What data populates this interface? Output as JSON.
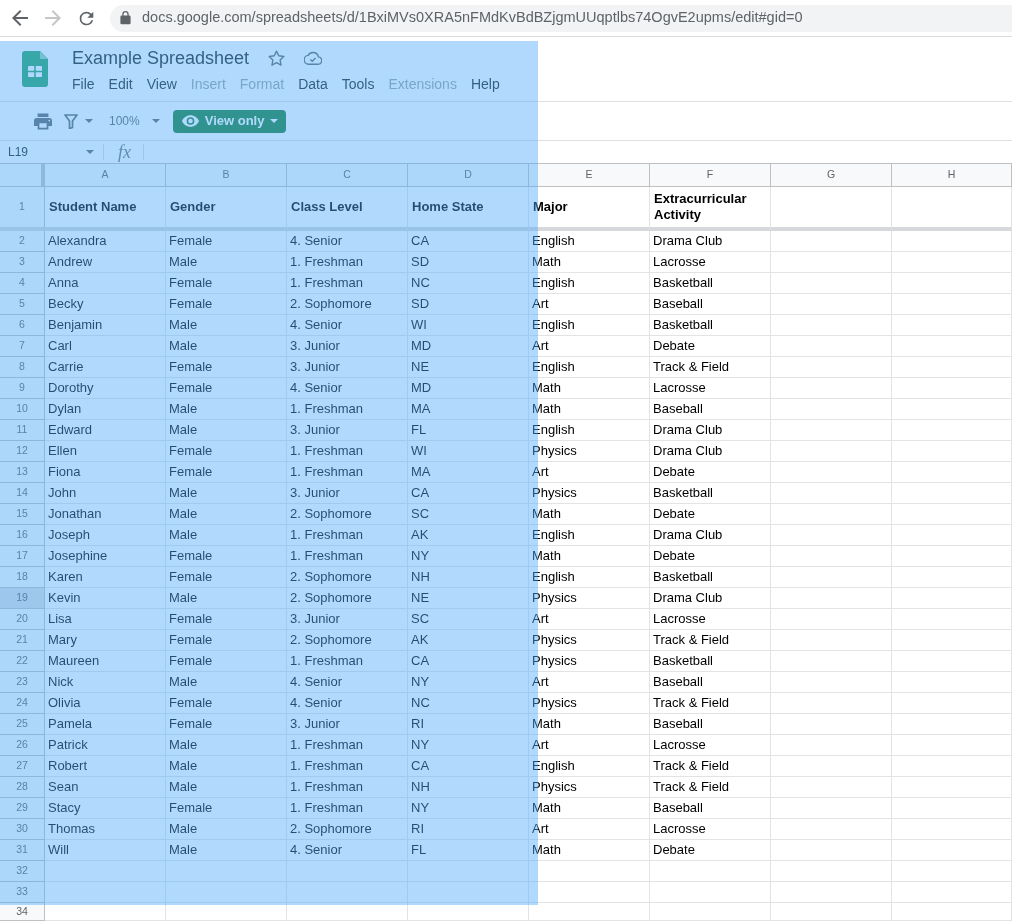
{
  "browser": {
    "back_disabled": false,
    "forward_disabled": true,
    "url": "docs.google.com/spreadsheets/d/1BxiMVs0XRA5nFMdKvBdBZjgmUUqptlbs74OgvE2upms/edit#gid=0"
  },
  "document": {
    "title": "Example Spreadsheet",
    "starred": false
  },
  "menu": [
    {
      "label": "File",
      "disabled": false
    },
    {
      "label": "Edit",
      "disabled": false
    },
    {
      "label": "View",
      "disabled": false
    },
    {
      "label": "Insert",
      "disabled": true
    },
    {
      "label": "Format",
      "disabled": true
    },
    {
      "label": "Data",
      "disabled": false
    },
    {
      "label": "Tools",
      "disabled": false
    },
    {
      "label": "Extensions",
      "disabled": true
    },
    {
      "label": "Help",
      "disabled": false
    }
  ],
  "toolbar": {
    "zoom": "100%",
    "mode_button": "View only"
  },
  "formula_bar": {
    "cell_reference": "L19",
    "function_label": "fx"
  },
  "sheet": {
    "columns": [
      "A",
      "B",
      "C",
      "D",
      "E",
      "F",
      "G",
      "H"
    ],
    "rows": [
      {
        "number": "1",
        "kind": "header",
        "selected": false,
        "cells": [
          "Student Name",
          "Gender",
          "Class Level",
          "Home State",
          "Major",
          "Extracurricular Activity"
        ]
      },
      {
        "number": "2",
        "kind": "data",
        "selected": false,
        "cells": [
          "Alexandra",
          "Female",
          "4. Senior",
          "CA",
          "English",
          "Drama Club"
        ]
      },
      {
        "number": "3",
        "kind": "data",
        "selected": false,
        "cells": [
          "Andrew",
          "Male",
          "1. Freshman",
          "SD",
          "Math",
          "Lacrosse"
        ]
      },
      {
        "number": "4",
        "kind": "data",
        "selected": false,
        "cells": [
          "Anna",
          "Female",
          "1. Freshman",
          "NC",
          "English",
          "Basketball"
        ]
      },
      {
        "number": "5",
        "kind": "data",
        "selected": false,
        "cells": [
          "Becky",
          "Female",
          "2. Sophomore",
          "SD",
          "Art",
          "Baseball"
        ]
      },
      {
        "number": "6",
        "kind": "data",
        "selected": false,
        "cells": [
          "Benjamin",
          "Male",
          "4. Senior",
          "WI",
          "English",
          "Basketball"
        ]
      },
      {
        "number": "7",
        "kind": "data",
        "selected": false,
        "cells": [
          "Carl",
          "Male",
          "3. Junior",
          "MD",
          "Art",
          "Debate"
        ]
      },
      {
        "number": "8",
        "kind": "data",
        "selected": false,
        "cells": [
          "Carrie",
          "Female",
          "3. Junior",
          "NE",
          "English",
          "Track & Field"
        ]
      },
      {
        "number": "9",
        "kind": "data",
        "selected": false,
        "cells": [
          "Dorothy",
          "Female",
          "4. Senior",
          "MD",
          "Math",
          "Lacrosse"
        ]
      },
      {
        "number": "10",
        "kind": "data",
        "selected": false,
        "cells": [
          "Dylan",
          "Male",
          "1. Freshman",
          "MA",
          "Math",
          "Baseball"
        ]
      },
      {
        "number": "11",
        "kind": "data",
        "selected": false,
        "cells": [
          "Edward",
          "Male",
          "3. Junior",
          "FL",
          "English",
          "Drama Club"
        ]
      },
      {
        "number": "12",
        "kind": "data",
        "selected": false,
        "cells": [
          "Ellen",
          "Female",
          "1. Freshman",
          "WI",
          "Physics",
          "Drama Club"
        ]
      },
      {
        "number": "13",
        "kind": "data",
        "selected": false,
        "cells": [
          "Fiona",
          "Female",
          "1. Freshman",
          "MA",
          "Art",
          "Debate"
        ]
      },
      {
        "number": "14",
        "kind": "data",
        "selected": false,
        "cells": [
          "John",
          "Male",
          "3. Junior",
          "CA",
          "Physics",
          "Basketball"
        ]
      },
      {
        "number": "15",
        "kind": "data",
        "selected": false,
        "cells": [
          "Jonathan",
          "Male",
          "2. Sophomore",
          "SC",
          "Math",
          "Debate"
        ]
      },
      {
        "number": "16",
        "kind": "data",
        "selected": false,
        "cells": [
          "Joseph",
          "Male",
          "1. Freshman",
          "AK",
          "English",
          "Drama Club"
        ]
      },
      {
        "number": "17",
        "kind": "data",
        "selected": false,
        "cells": [
          "Josephine",
          "Female",
          "1. Freshman",
          "NY",
          "Math",
          "Debate"
        ]
      },
      {
        "number": "18",
        "kind": "data",
        "selected": false,
        "cells": [
          "Karen",
          "Female",
          "2. Sophomore",
          "NH",
          "English",
          "Basketball"
        ]
      },
      {
        "number": "19",
        "kind": "data",
        "selected": true,
        "cells": [
          "Kevin",
          "Male",
          "2. Sophomore",
          "NE",
          "Physics",
          "Drama Club"
        ]
      },
      {
        "number": "20",
        "kind": "data",
        "selected": false,
        "cells": [
          "Lisa",
          "Female",
          "3. Junior",
          "SC",
          "Art",
          "Lacrosse"
        ]
      },
      {
        "number": "21",
        "kind": "data",
        "selected": false,
        "cells": [
          "Mary",
          "Female",
          "2. Sophomore",
          "AK",
          "Physics",
          "Track & Field"
        ]
      },
      {
        "number": "22",
        "kind": "data",
        "selected": false,
        "cells": [
          "Maureen",
          "Female",
          "1. Freshman",
          "CA",
          "Physics",
          "Basketball"
        ]
      },
      {
        "number": "23",
        "kind": "data",
        "selected": false,
        "cells": [
          "Nick",
          "Male",
          "4. Senior",
          "NY",
          "Art",
          "Baseball"
        ]
      },
      {
        "number": "24",
        "kind": "data",
        "selected": false,
        "cells": [
          "Olivia",
          "Female",
          "4. Senior",
          "NC",
          "Physics",
          "Track & Field"
        ]
      },
      {
        "number": "25",
        "kind": "data",
        "selected": false,
        "cells": [
          "Pamela",
          "Female",
          "3. Junior",
          "RI",
          "Math",
          "Baseball"
        ]
      },
      {
        "number": "26",
        "kind": "data",
        "selected": false,
        "cells": [
          "Patrick",
          "Male",
          "1. Freshman",
          "NY",
          "Art",
          "Lacrosse"
        ]
      },
      {
        "number": "27",
        "kind": "data",
        "selected": false,
        "cells": [
          "Robert",
          "Male",
          "1. Freshman",
          "CA",
          "English",
          "Track & Field"
        ]
      },
      {
        "number": "28",
        "kind": "data",
        "selected": false,
        "cells": [
          "Sean",
          "Male",
          "1. Freshman",
          "NH",
          "Physics",
          "Track & Field"
        ]
      },
      {
        "number": "29",
        "kind": "data",
        "selected": false,
        "cells": [
          "Stacy",
          "Female",
          "1. Freshman",
          "NY",
          "Math",
          "Baseball"
        ]
      },
      {
        "number": "30",
        "kind": "data",
        "selected": false,
        "cells": [
          "Thomas",
          "Male",
          "2. Sophomore",
          "RI",
          "Art",
          "Lacrosse"
        ]
      },
      {
        "number": "31",
        "kind": "data",
        "selected": false,
        "cells": [
          "Will",
          "Male",
          "4. Senior",
          "FL",
          "Math",
          "Debate"
        ]
      },
      {
        "number": "32",
        "kind": "data",
        "selected": false
      },
      {
        "number": "33",
        "kind": "data",
        "selected": false
      },
      {
        "number": "34",
        "kind": "data",
        "selected": false
      }
    ]
  }
}
